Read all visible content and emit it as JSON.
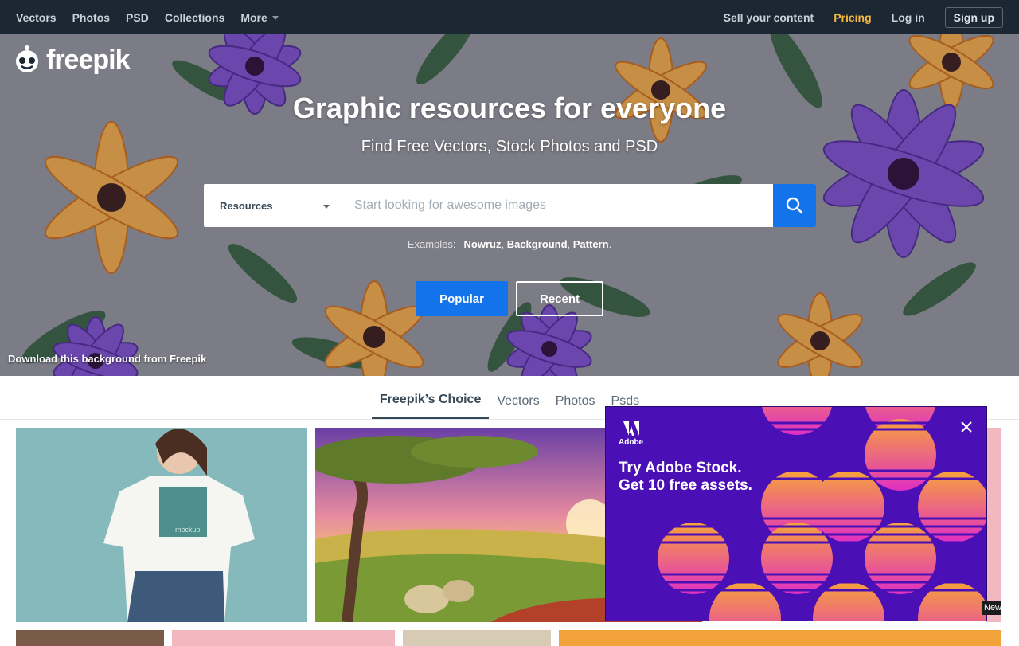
{
  "nav": {
    "left": [
      "Vectors",
      "Photos",
      "PSD",
      "Collections"
    ],
    "more": "More",
    "sell": "Sell your content",
    "pricing": "Pricing",
    "login": "Log in",
    "signup": "Sign up"
  },
  "hero": {
    "logo_text": "freepik",
    "title": "Graphic resources for everyone",
    "subtitle": "Find Free Vectors, Stock Photos and PSD",
    "search": {
      "selector": "Resources",
      "placeholder": "Start looking for awesome images"
    },
    "examples_label": "Examples:",
    "examples": [
      "Nowruz",
      "Background",
      "Pattern"
    ],
    "popular": "Popular",
    "recent": "Recent",
    "credit": "Download this background from Freepik"
  },
  "tabs": [
    "Freepik’s Choice",
    "Vectors",
    "Photos",
    "Psds"
  ],
  "gallery": {
    "mockup_label": "mockup",
    "new_badge": "New"
  },
  "ad": {
    "brand": "Adobe",
    "headline": "Try Adobe Stock.",
    "subline": "Get 10 free assets."
  },
  "colors": {
    "nav_bg": "#1b2733",
    "accent": "#1273eb",
    "pricing": "#f4b740",
    "ad_bg": "#4a0fb5"
  }
}
